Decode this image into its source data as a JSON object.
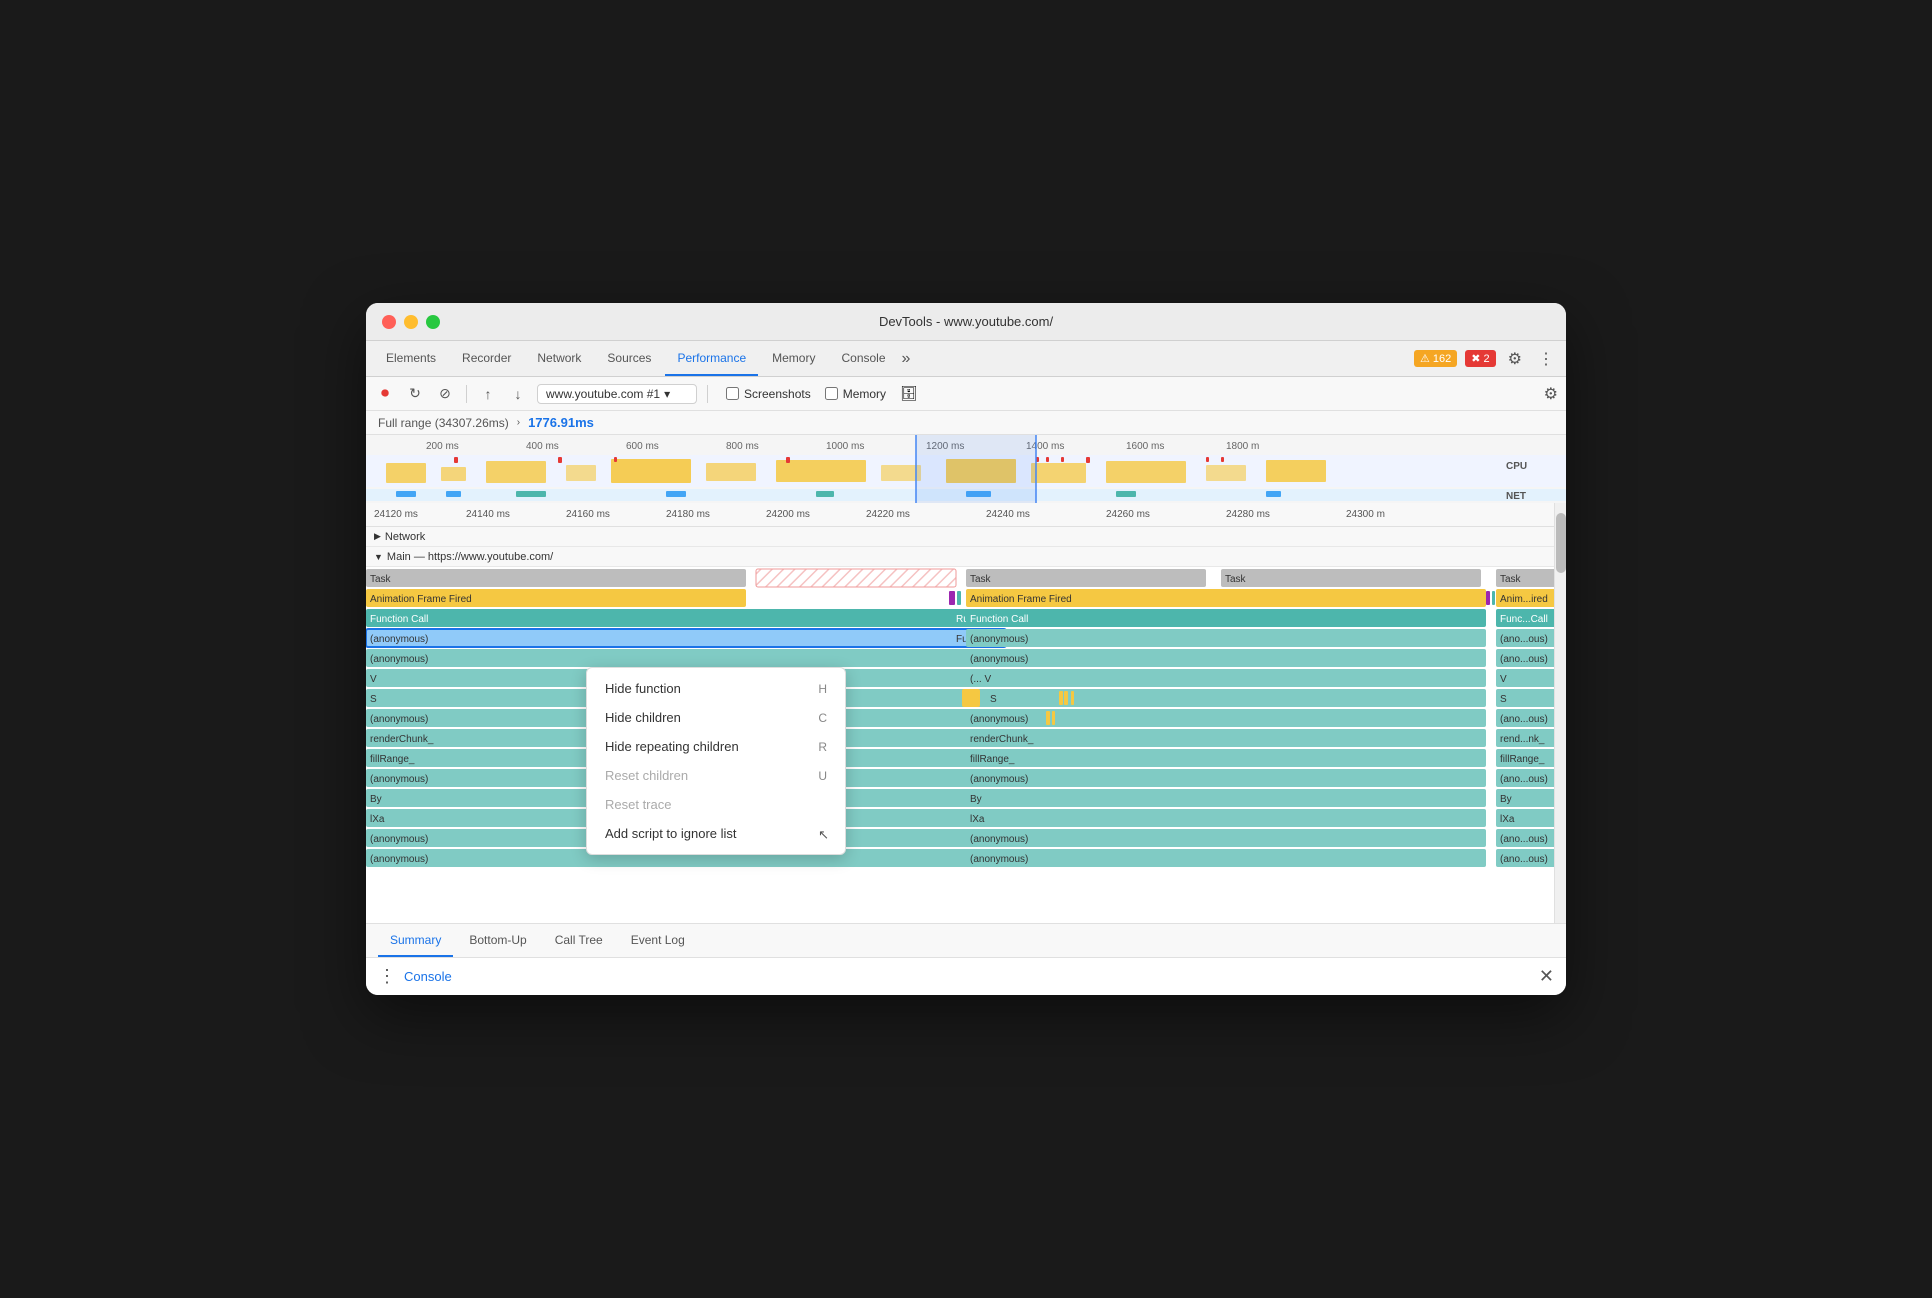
{
  "window": {
    "title": "DevTools - www.youtube.com/"
  },
  "traffic_lights": {
    "red": "red",
    "yellow": "yellow",
    "green": "green"
  },
  "tabs": [
    {
      "id": "elements",
      "label": "Elements"
    },
    {
      "id": "recorder",
      "label": "Recorder"
    },
    {
      "id": "network",
      "label": "Network"
    },
    {
      "id": "sources",
      "label": "Sources"
    },
    {
      "id": "performance",
      "label": "Performance",
      "active": true
    },
    {
      "id": "memory",
      "label": "Memory"
    },
    {
      "id": "console",
      "label": "Console"
    }
  ],
  "toolbar": {
    "record_label": "●",
    "reload_label": "↻",
    "clear_label": "⊘",
    "upload_label": "↑",
    "download_label": "↓",
    "url_value": "www.youtube.com #1",
    "screenshots_label": "Screenshots",
    "memory_label": "Memory"
  },
  "range": {
    "full_range": "Full range (34307.26ms)",
    "arrow": "›",
    "selected": "1776.91ms"
  },
  "ruler": {
    "ticks": [
      "200 ms",
      "400 ms",
      "600 ms",
      "800 ms",
      "1000 ms",
      "1200 ms",
      "1400 ms",
      "1600 ms",
      "1800 m"
    ]
  },
  "main_ruler": {
    "ticks": [
      "24120 ms",
      "24140 ms",
      "24160 ms",
      "24180 ms",
      "24200 ms",
      "24220 ms",
      "24240 ms",
      "24260 ms",
      "24280 ms",
      "24300 m"
    ]
  },
  "sections": {
    "network": "Network",
    "main": "Main — https://www.youtube.com/"
  },
  "flame_rows": [
    {
      "label": "Task",
      "type": "task"
    },
    {
      "label": "Animation Frame Fired",
      "type": "animation"
    },
    {
      "label": "Function Call",
      "type": "function"
    },
    {
      "label": "(anonymous)",
      "type": "anon"
    },
    {
      "label": "(anonymous)",
      "type": "anon"
    },
    {
      "label": "V",
      "type": "v"
    },
    {
      "label": "S",
      "type": "s"
    },
    {
      "label": "(anonymous)",
      "type": "anon"
    },
    {
      "label": "renderChunk_",
      "type": "func"
    },
    {
      "label": "fillRange_",
      "type": "func"
    },
    {
      "label": "(anonymous)",
      "type": "anon"
    },
    {
      "label": "By",
      "type": "func"
    },
    {
      "label": "lXa",
      "type": "func"
    },
    {
      "label": "(anonymous)",
      "type": "anon"
    },
    {
      "label": "(anonymous)",
      "type": "anon"
    }
  ],
  "context_menu": {
    "items": [
      {
        "label": "Hide function",
        "shortcut": "H",
        "enabled": true
      },
      {
        "label": "Hide children",
        "shortcut": "C",
        "enabled": true
      },
      {
        "label": "Hide repeating children",
        "shortcut": "R",
        "enabled": true
      },
      {
        "label": "Reset children",
        "shortcut": "U",
        "enabled": false
      },
      {
        "label": "Reset trace",
        "shortcut": "",
        "enabled": false
      },
      {
        "label": "Add script to ignore list",
        "shortcut": "",
        "enabled": true
      }
    ]
  },
  "bottom_tabs": [
    {
      "id": "summary",
      "label": "Summary",
      "active": true
    },
    {
      "id": "bottom-up",
      "label": "Bottom-Up"
    },
    {
      "id": "call-tree",
      "label": "Call Tree"
    },
    {
      "id": "event-log",
      "label": "Event Log"
    }
  ],
  "console_bar": {
    "dots": "⋮",
    "label": "Console",
    "close": "✕"
  },
  "badges": {
    "warning": "162",
    "error": "2"
  }
}
